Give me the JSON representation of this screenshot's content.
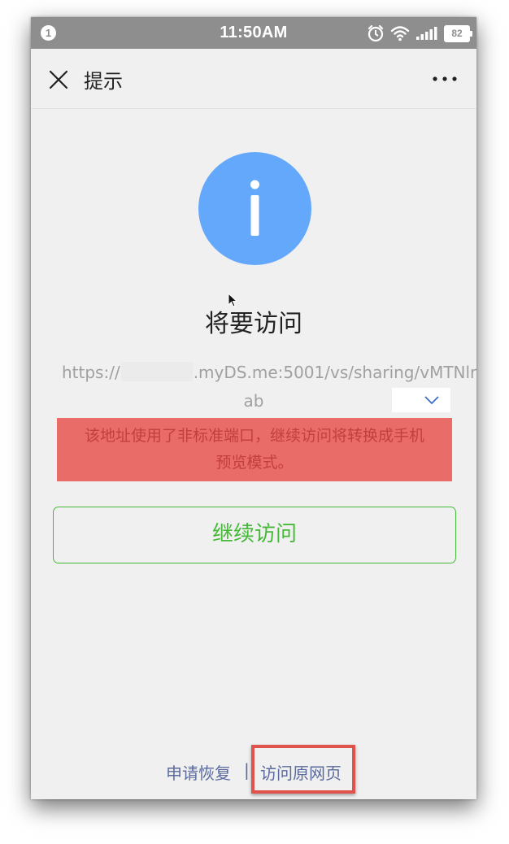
{
  "status_bar": {
    "notification_count": "1",
    "time": "11:50AM",
    "battery": "82",
    "icons": [
      "alarm-icon",
      "wifi-icon",
      "signal-icon",
      "battery-icon"
    ]
  },
  "nav": {
    "title": "提示",
    "close_icon": "close-icon",
    "more_icon": "more-icon"
  },
  "main": {
    "info_icon": "info-icon",
    "heading": "将要访问",
    "url_prefix": "https://",
    "url_suffix": ".myDS.me:5001/vs/sharing/vMTNlr",
    "url_line2": "ab",
    "warning_line1": "该地址使用了非标准端口，继续访问将转换成手机",
    "warning_line2": "预览模式。",
    "continue_button": "继续访问"
  },
  "footer": {
    "reapply_link": "申请恢复",
    "separator": "|",
    "original_link": "访问原网页"
  },
  "colors": {
    "status_bar": "#8e8e8e",
    "background": "#f0f0f0",
    "info_blue": "#64a8fb",
    "warning_red": "#e96c69",
    "continue_green": "#46b938",
    "link": "#5a6a9c",
    "highlight": "#e0534d"
  }
}
